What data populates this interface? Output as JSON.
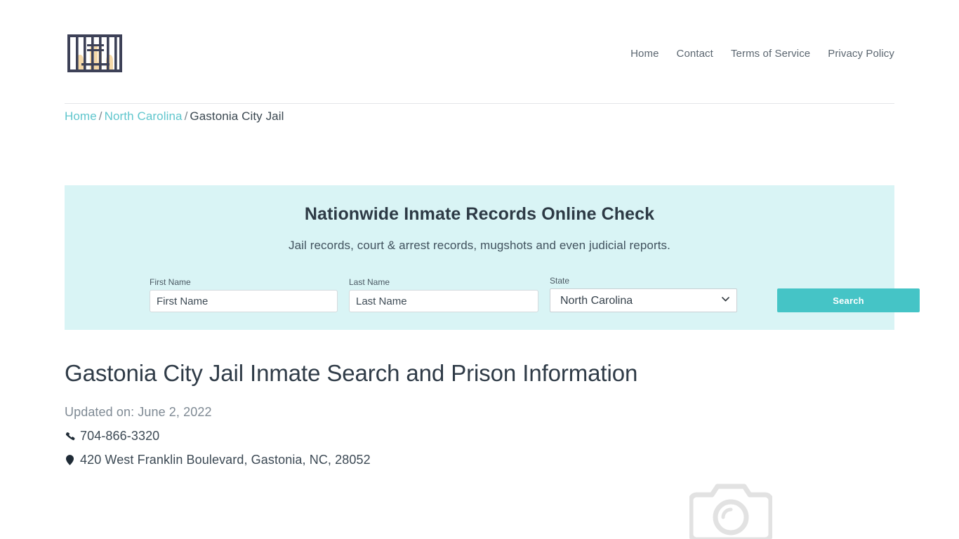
{
  "header": {
    "logo_name": "jail-bars-logo",
    "nav": [
      {
        "label": "Home"
      },
      {
        "label": "Contact"
      },
      {
        "label": "Terms of Service"
      },
      {
        "label": "Privacy Policy"
      }
    ]
  },
  "breadcrumb": {
    "items": [
      {
        "label": "Home",
        "link": true
      },
      {
        "label": "North Carolina",
        "link": true
      },
      {
        "label": "Gastonia City Jail",
        "link": false
      }
    ],
    "separator": "/"
  },
  "search_panel": {
    "title": "Nationwide Inmate Records Online Check",
    "subtitle": "Jail records, court & arrest records, mugshots and even judicial reports.",
    "fields": {
      "first_name": {
        "label": "First Name",
        "value": "",
        "placeholder": "First Name"
      },
      "last_name": {
        "label": "Last Name",
        "value": "",
        "placeholder": "Last Name"
      },
      "state": {
        "label": "State",
        "selected": "North Carolina"
      }
    },
    "search_button": "Search"
  },
  "main": {
    "title": "Gastonia City Jail Inmate Search and Prison Information",
    "updated": "Updated on: June 2, 2022",
    "phone": "704-866-3320",
    "address": "420 West Franklin Boulevard, Gastonia, NC, 28052"
  },
  "colors": {
    "accent": "#45c4c6",
    "panel_bg": "#d9f4f5",
    "link": "#5fc6cd",
    "text_dark": "#2f3b47",
    "text_muted": "#7f8a94",
    "logo_bars": "#3d4157",
    "logo_hands": "#f6d9a8",
    "placeholder_gray": "#e0e0e0"
  }
}
